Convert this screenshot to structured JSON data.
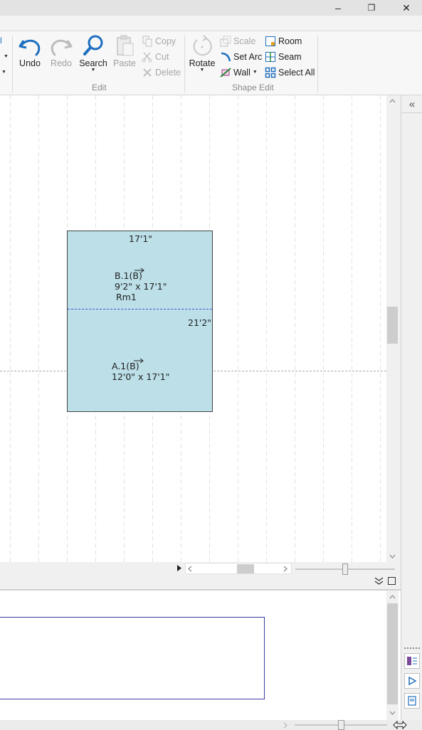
{
  "window": {
    "min_glyph": "–",
    "restore_glyph": "❐",
    "close_glyph": "✕"
  },
  "ribbon": {
    "undo": "Undo",
    "redo": "Redo",
    "search": "Search",
    "paste": "Paste",
    "copy": "Copy",
    "cut": "Cut",
    "delete": "Delete",
    "rotate": "Rotate",
    "scale": "Scale",
    "set_arc": "Set Arc",
    "wall": "Wall",
    "room": "Room",
    "seam": "Seam",
    "select_all": "Select All",
    "group_edit": "Edit",
    "group_shape_edit": "Shape Edit",
    "left_fragment": "l"
  },
  "canvas": {
    "top_dimension": "17'1\"",
    "side_dimension": "21'2\"",
    "region_b_name": "B.1(B)",
    "region_b_size": "9'2\" x 17'1\"",
    "region_b_room": "Rm1",
    "region_a_name": "A.1(B)",
    "region_a_size": "12'0\" x 17'1\""
  },
  "right_panel": {
    "collapse_glyph": "«"
  },
  "colors": {
    "room_fill": "#bcdfe8",
    "seam_line": "#3a57d8",
    "accent_blue": "#1e6fbf",
    "selection_border": "#3a3aa0"
  },
  "icons": [
    "undo-icon",
    "redo-icon",
    "search-icon",
    "paste-icon",
    "copy-icon",
    "cut-icon",
    "delete-icon",
    "rotate-icon",
    "scale-icon",
    "set-arc-icon",
    "wall-icon",
    "room-icon",
    "seam-icon",
    "select-all-icon"
  ]
}
